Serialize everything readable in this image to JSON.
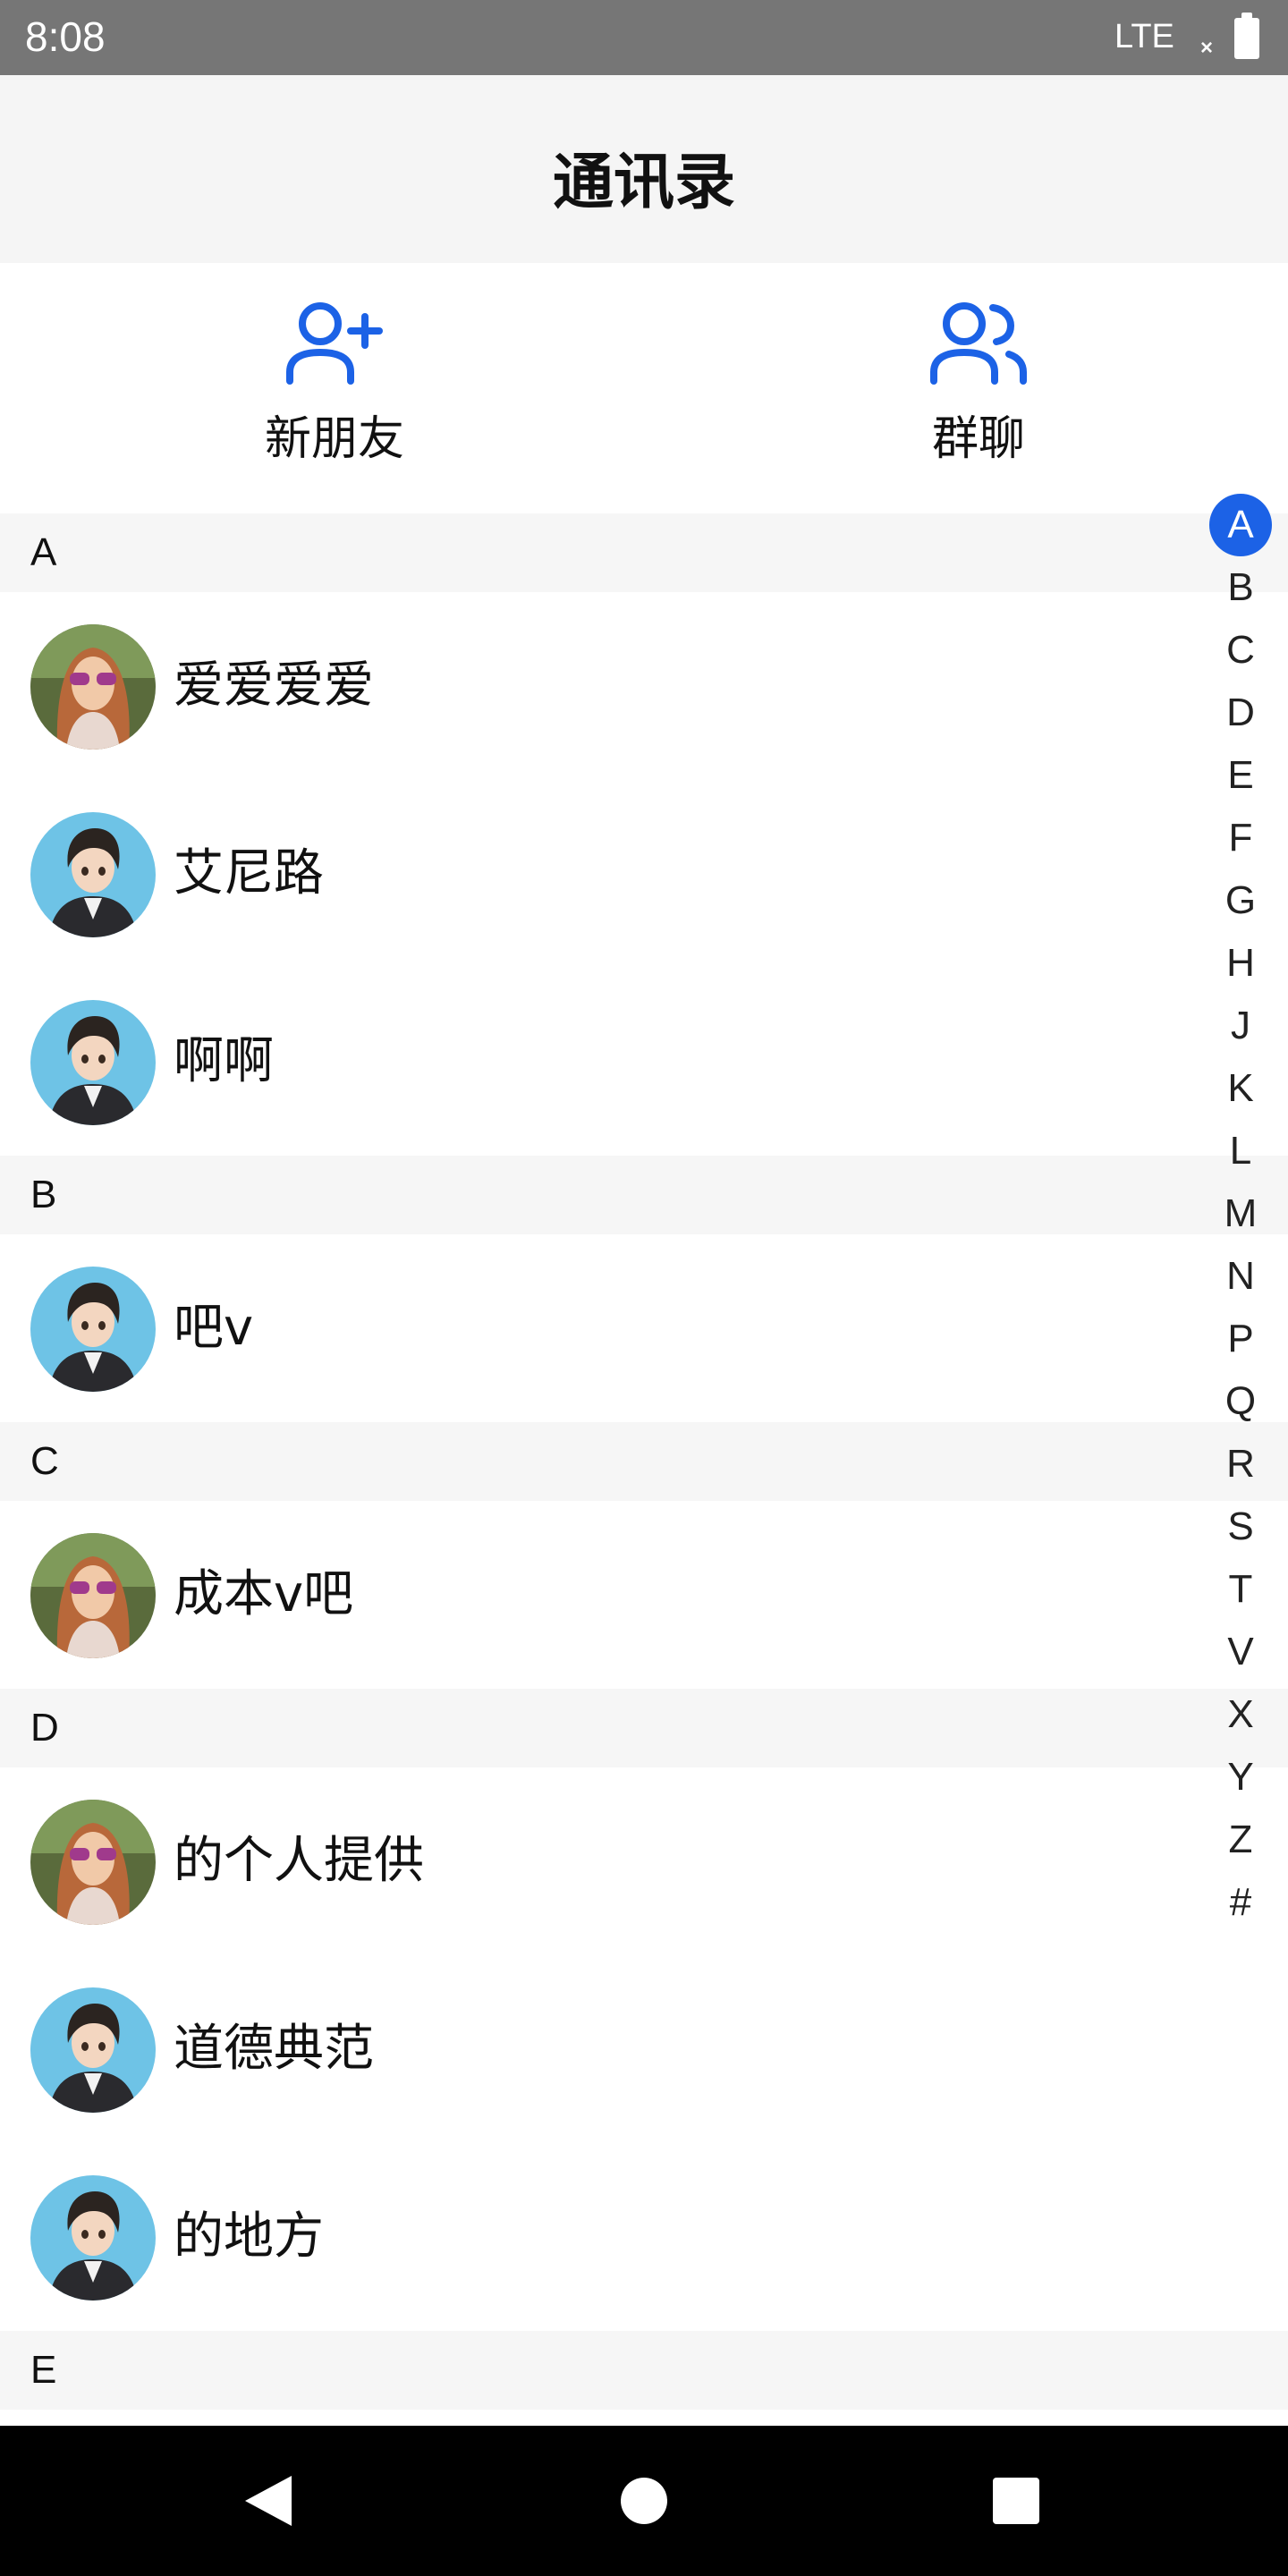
{
  "status_bar": {
    "time": "8:08",
    "network": "LTE",
    "signal_mark": "×",
    "battery_icon": "battery-full"
  },
  "header": {
    "title": "通讯录"
  },
  "actions": [
    {
      "label": "新朋友",
      "icon": "person-add-icon",
      "color": "#1c62e6"
    },
    {
      "label": "群聊",
      "icon": "people-group-icon",
      "color": "#1c62e6"
    }
  ],
  "sections": [
    {
      "letter": "A",
      "contacts": [
        {
          "name": "爱爱爱爱",
          "avatar": "girl-sunglasses"
        },
        {
          "name": "艾尼路",
          "avatar": "anime-boy"
        },
        {
          "name": "啊啊",
          "avatar": "anime-boy"
        }
      ]
    },
    {
      "letter": "B",
      "contacts": [
        {
          "name": "吧v",
          "avatar": "anime-boy"
        }
      ]
    },
    {
      "letter": "C",
      "contacts": [
        {
          "name": "成本v吧",
          "avatar": "girl-sunglasses"
        }
      ]
    },
    {
      "letter": "D",
      "contacts": [
        {
          "name": "的个人提供",
          "avatar": "girl-sunglasses"
        },
        {
          "name": "道德典范",
          "avatar": "anime-boy"
        },
        {
          "name": "的地方",
          "avatar": "anime-boy"
        }
      ]
    },
    {
      "letter": "E",
      "contacts": []
    }
  ],
  "index_bar": {
    "letters": [
      "A",
      "B",
      "C",
      "D",
      "E",
      "F",
      "G",
      "H",
      "J",
      "K",
      "L",
      "M",
      "N",
      "P",
      "Q",
      "R",
      "S",
      "T",
      "V",
      "X",
      "Y",
      "Z",
      "#"
    ],
    "active": "A",
    "active_color": "#1c62e6"
  },
  "nav_bar": {
    "back_icon": "back-triangle-icon",
    "home_icon": "home-circle-icon",
    "recents_icon": "recents-square-icon"
  }
}
